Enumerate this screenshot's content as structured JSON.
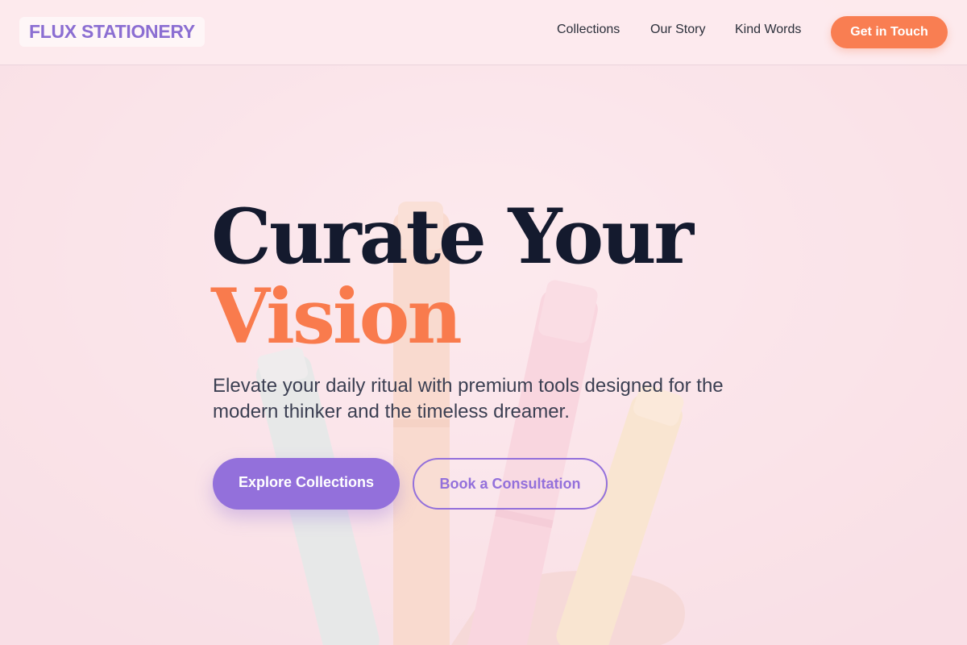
{
  "header": {
    "logo": "FLUX STATIONERY",
    "nav": [
      "Collections",
      "Our Story",
      "Kind Words"
    ],
    "cta": "Get in Touch"
  },
  "hero": {
    "headline_line1": "Curate Your",
    "headline_line2": "Vision",
    "subtitle": "Elevate your daily ritual with premium tools designed for the modern thinker and the timeless dreamer.",
    "primary_button": "Explore Collections",
    "secondary_button": "Book a Consultation",
    "background_image": "pastel-highlighters-in-hand"
  },
  "colors": {
    "background": "#fbe6ea",
    "accent_purple": "#9370db",
    "accent_orange": "#f97e52",
    "heading": "#141a2e",
    "body_text": "#3b3f52"
  }
}
